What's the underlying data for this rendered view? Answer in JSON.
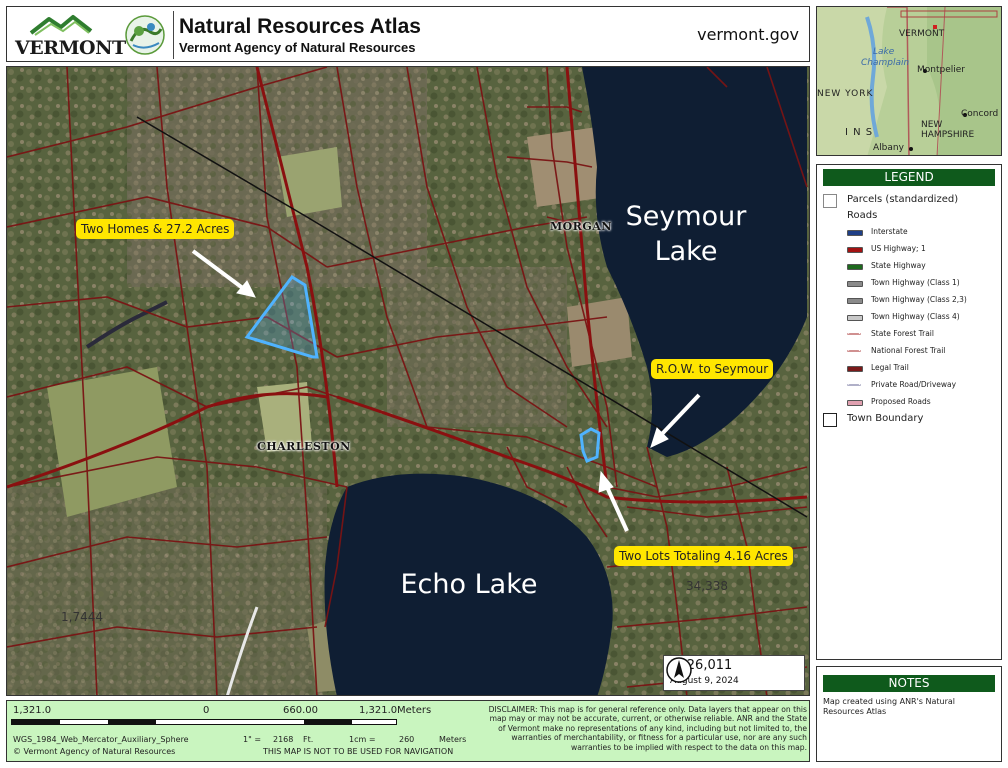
{
  "header": {
    "logo_word": "VERMONT",
    "title": "Natural Resources Atlas",
    "subtitle": "Vermont Agency of Natural Resources",
    "url": "vermont.gov"
  },
  "map": {
    "callouts": {
      "two_homes": "Two Homes & 27.2 Acres",
      "row": "R.O.W. to Seymour",
      "two_lots": "Two Lots Totaling 4.16 Acres"
    },
    "lakes": {
      "seymour_line1": "Seymour",
      "seymour_line2": "Lake",
      "echo": "Echo Lake"
    },
    "towns": {
      "morgan": "MORGAN",
      "charleston": "CHARLESTON"
    },
    "parcel_numbers": {
      "a": "34,338",
      "b": "1,7444"
    },
    "scale": {
      "ratio": "1: 26,011",
      "date": "August 9, 2024"
    },
    "colors": {
      "parcel_line": "#7a1414",
      "highlight": "#4fb3ff",
      "lake": "#0f1e33",
      "callout": "#ffe600"
    }
  },
  "inset": {
    "labels": {
      "vermont": "VERMONT",
      "lake": "Lake",
      "champlain": "Champlain",
      "montpelier": "Montpelier",
      "new_york": "NEW YORK",
      "concord": "Concord",
      "new": "NEW",
      "hampshire": "HAMPSHIRE",
      "albany": "Albany",
      "ins": "I N S"
    }
  },
  "legend": {
    "title": "LEGEND",
    "parcels": "Parcels (standardized)",
    "roads": "Roads",
    "road_items": [
      {
        "label": "Interstate",
        "color": "#1f3f86",
        "style": "solid"
      },
      {
        "label": "US Highway; 1",
        "color": "#a31212",
        "style": "solid"
      },
      {
        "label": "State Highway",
        "color": "#1e6a1e",
        "style": "solid"
      },
      {
        "label": "Town Highway (Class 1)",
        "color": "#8a8a8a",
        "style": "solid"
      },
      {
        "label": "Town Highway (Class 2,3)",
        "color": "#8a8a8a",
        "style": "solid"
      },
      {
        "label": "Town Highway (Class 4)",
        "color": "#c8c8c8",
        "style": "solid"
      },
      {
        "label": "State Forest Trail",
        "color": "#d09090",
        "style": "dashed"
      },
      {
        "label": "National Forest Trail",
        "color": "#d09090",
        "style": "dashed"
      },
      {
        "label": "Legal Trail",
        "color": "#7a1a1a",
        "style": "solid"
      },
      {
        "label": "Private Road/Driveway",
        "color": "#b0b0c8",
        "style": "dashed"
      },
      {
        "label": "Proposed Roads",
        "color": "#e0a0b0",
        "style": "solid"
      }
    ],
    "town_boundary": "Town Boundary"
  },
  "notes": {
    "title": "NOTES",
    "text": "Map created using ANR's Natural Resources Atlas"
  },
  "footer": {
    "scale_left": "1,321.0",
    "scale_zero": "0",
    "scale_mid": "660.00",
    "scale_right": "1,321.0",
    "scale_units": "Meters",
    "projection": "WGS_1984_Web_Mercator_Auxiliary_Sphere",
    "copyright": "© Vermont Agency of Natural Resources",
    "inch_label": "1\" =",
    "inch_value": "2168",
    "inch_unit": "Ft.",
    "cm_label": "1cm =",
    "cm_value": "260",
    "cm_unit": "Meters",
    "nav_warning": "THIS MAP IS NOT TO BE USED FOR NAVIGATION",
    "disclaimer": "DISCLAIMER: This map is for general reference only. Data layers that appear on this map may or may not be accurate, current, or otherwise reliable. ANR and the State of Vermont make no representations of any kind, including but not limited to, the warranties of merchantability, or fitness for a particular use, nor are any such warranties to be implied with respect to the data on this map."
  }
}
